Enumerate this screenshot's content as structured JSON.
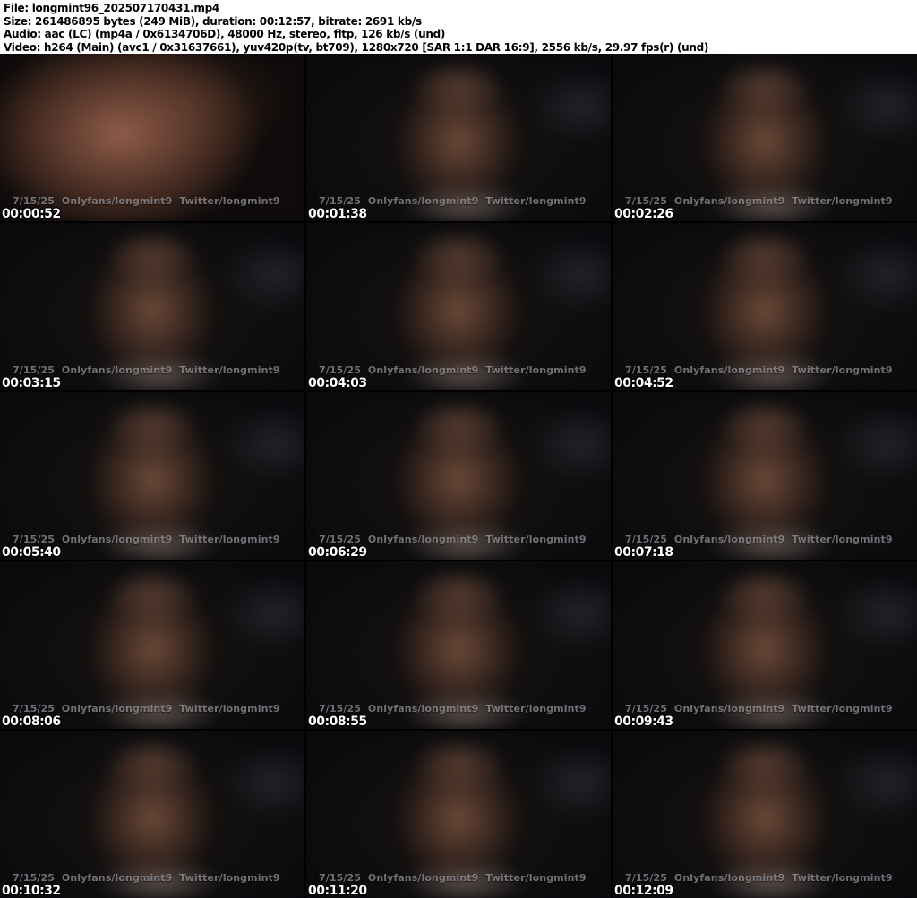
{
  "header": {
    "lines": [
      "File: longmint96_202507170431.mp4",
      "Size: 261486895 bytes (249 MiB), duration: 00:12:57, bitrate: 2691 kb/s",
      "Audio: aac (LC) (mp4a / 0x6134706D), 48000 Hz, stereo, fltp, 126 kb/s (und)",
      "Video: h264 (Main) (avc1 / 0x31637661), yuv420p(tv, bt709), 1280x720 [SAR 1:1 DAR 16:9], 2556 kb/s, 29.97 fps(r) (und)"
    ]
  },
  "grid": {
    "watermark": "7/15/25  Onlyfans/longmint9  Twitter/longmint9",
    "thumbnails": [
      {
        "timestamp": "00:00:52"
      },
      {
        "timestamp": "00:01:38"
      },
      {
        "timestamp": "00:02:26"
      },
      {
        "timestamp": "00:03:15"
      },
      {
        "timestamp": "00:04:03"
      },
      {
        "timestamp": "00:04:52"
      },
      {
        "timestamp": "00:05:40"
      },
      {
        "timestamp": "00:06:29"
      },
      {
        "timestamp": "00:07:18"
      },
      {
        "timestamp": "00:08:06"
      },
      {
        "timestamp": "00:08:55"
      },
      {
        "timestamp": "00:09:43"
      },
      {
        "timestamp": "00:10:32"
      },
      {
        "timestamp": "00:11:20"
      },
      {
        "timestamp": "00:12:09"
      }
    ]
  },
  "colors": {
    "header_bg": "#ffffff",
    "header_text": "#000000",
    "grid_bg": "#000000",
    "timestamp_text": "#ffffff",
    "watermark_text": "#c8c6cd"
  }
}
